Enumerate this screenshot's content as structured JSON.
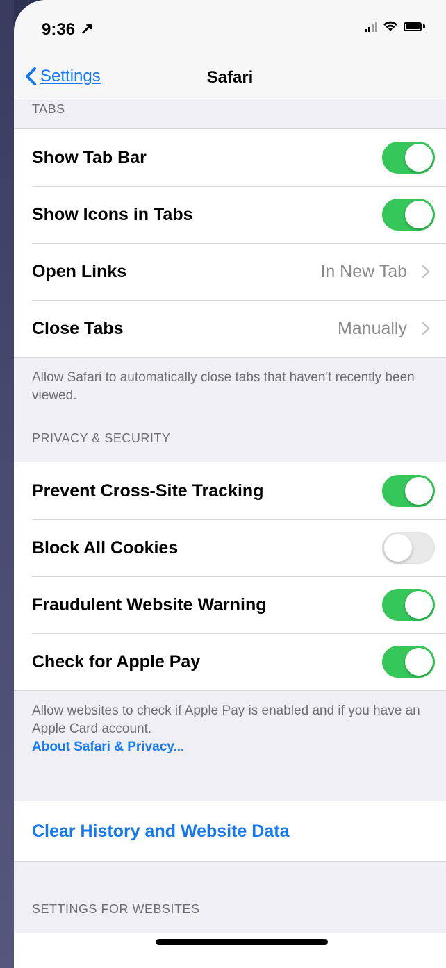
{
  "status_bar": {
    "time": "9:36 ↗"
  },
  "nav": {
    "back_label": "Settings",
    "title": "Safari"
  },
  "tabs_section": {
    "header": "TABS",
    "rows": [
      {
        "label": "Show Tab Bar",
        "toggle": "on"
      },
      {
        "label": "Show Icons in Tabs",
        "toggle": "on"
      },
      {
        "label": "Open Links",
        "value": "In New Tab"
      },
      {
        "label": "Close Tabs",
        "value": "Manually"
      }
    ],
    "footer": "Allow Safari to automatically close tabs that haven't recently been viewed."
  },
  "privacy_section": {
    "header": "PRIVACY & SECURITY",
    "rows": [
      {
        "label": "Prevent Cross-Site Tracking",
        "toggle": "on"
      },
      {
        "label": "Block All Cookies",
        "toggle": "off"
      },
      {
        "label": "Fraudulent Website Warning",
        "toggle": "on"
      },
      {
        "label": "Check for Apple Pay",
        "toggle": "on"
      }
    ],
    "footer": "Allow websites to check if Apple Pay is enabled and if you have an Apple Card account.",
    "footer_link": "About Safari & Privacy..."
  },
  "history_section": {
    "action": "Clear History and Website Data"
  },
  "websites_section": {
    "header": "SETTINGS FOR WEBSITES"
  },
  "colors": {
    "accent": "#1677f2",
    "toggle_on": "#35c759",
    "background": "#efeff4"
  }
}
